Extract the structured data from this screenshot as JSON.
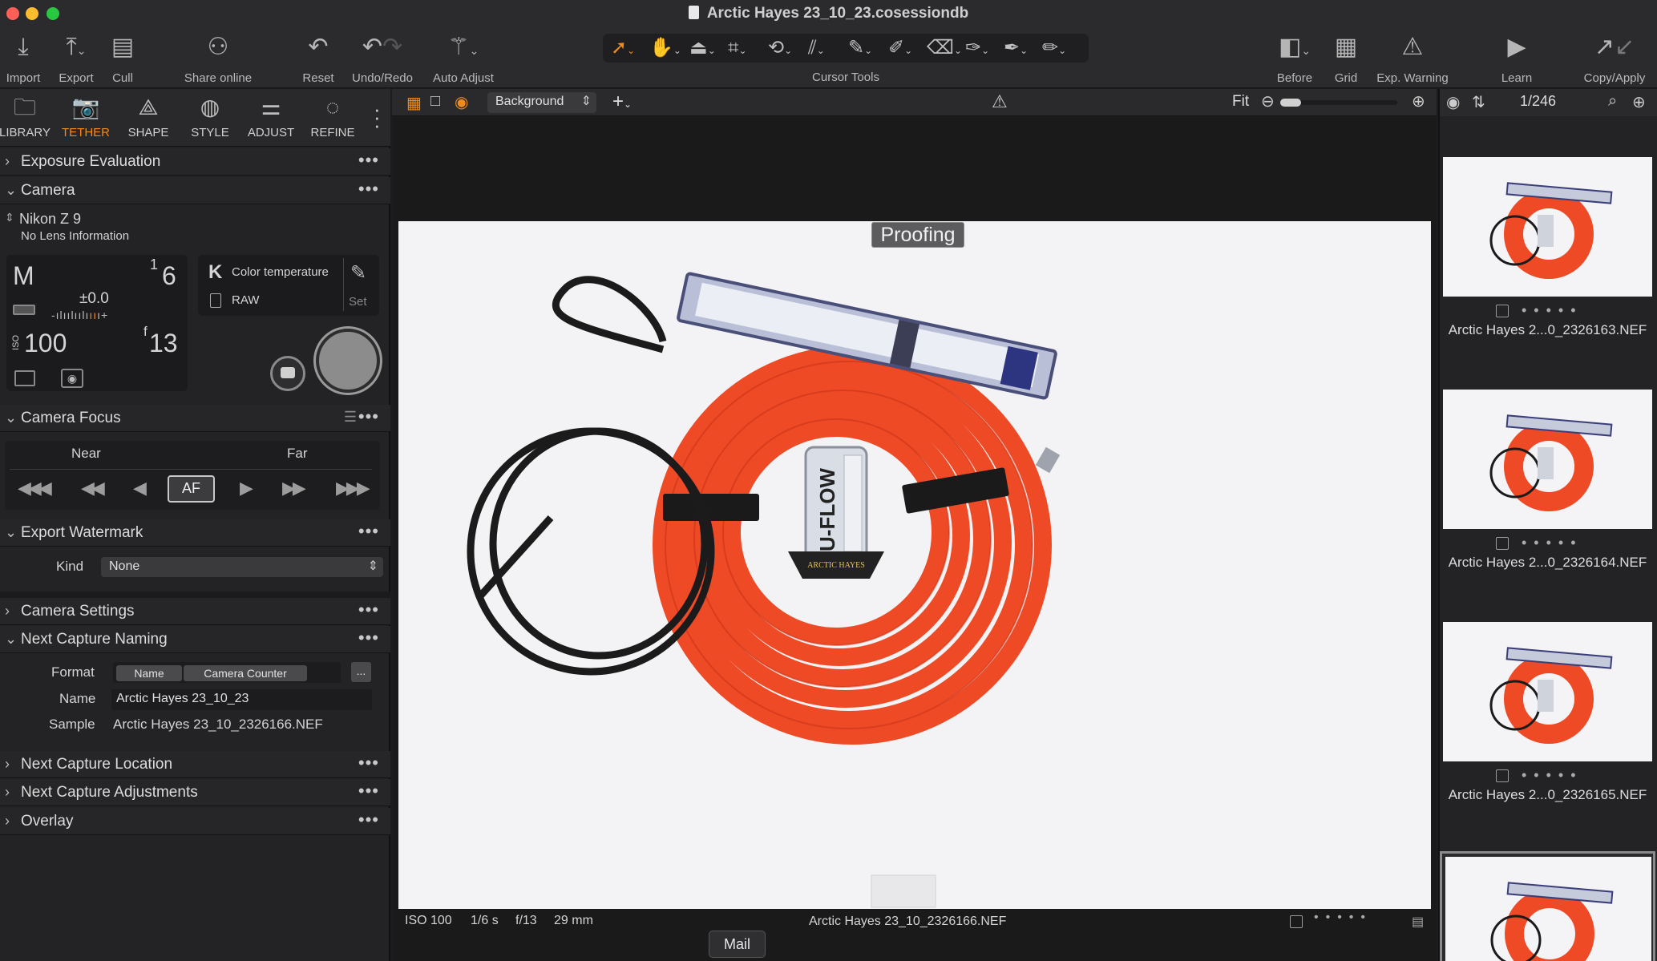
{
  "window": {
    "title": "Arctic Hayes 23_10_23.cosessiondb"
  },
  "toolbar": {
    "import": "Import",
    "export": "Export",
    "cull": "Cull",
    "share_online": "Share online",
    "reset": "Reset",
    "undo_redo": "Undo/Redo",
    "auto_adjust": "Auto Adjust",
    "cursor_tools": "Cursor Tools",
    "before": "Before",
    "grid": "Grid",
    "exp_warning": "Exp. Warning",
    "learn": "Learn",
    "copy_apply": "Copy/Apply"
  },
  "tool_tabs": [
    "LIBRARY",
    "TETHER",
    "SHAPE",
    "STYLE",
    "ADJUST",
    "REFINE"
  ],
  "active_tab": "TETHER",
  "sections": {
    "exposure_evaluation": "Exposure Evaluation",
    "camera": "Camera",
    "camera_focus": "Camera Focus",
    "export_watermark": "Export Watermark",
    "camera_settings": "Camera Settings",
    "next_capture_naming": "Next Capture Naming",
    "next_capture_location": "Next Capture Location",
    "next_capture_adjustments": "Next Capture Adjustments",
    "overlay": "Overlay"
  },
  "camera": {
    "model": "Nikon Z 9",
    "lens": "No Lens Information",
    "mode": "M",
    "shutter_num": "1",
    "shutter_den": "6",
    "exposure_comp": "±0.0",
    "iso_label": "ISO",
    "iso": "100",
    "aperture_f": "f",
    "aperture": "13",
    "wb_letter": "K",
    "wb_label": "Color temperature",
    "format": "RAW",
    "set_label": "Set"
  },
  "focus": {
    "near": "Near",
    "far": "Far",
    "af": "AF"
  },
  "watermark": {
    "kind_label": "Kind",
    "kind_value": "None"
  },
  "naming": {
    "format_label": "Format",
    "format_tokens": [
      "Name",
      "Camera Counter"
    ],
    "more": "...",
    "name_label": "Name",
    "name_value": "Arctic Hayes 23_10_23",
    "sample_label": "Sample",
    "sample_value": "Arctic Hayes 23_10_2326166.NEF"
  },
  "viewer": {
    "variant": "Background",
    "fit": "Fit",
    "proofing": "Proofing",
    "status": {
      "iso": "ISO 100",
      "shutter": "1/6 s",
      "aperture": "f/13",
      "focal": "29 mm",
      "filename": "Arctic Hayes 23_10_2326166.NEF"
    },
    "tooltip": "Mail"
  },
  "photo_labels": {
    "brand": "U-FLOW",
    "logo": "ARCTIC HAYES"
  },
  "browser": {
    "count": "1/246",
    "thumbs": [
      "Arctic Hayes 2...0_2326163.NEF",
      "Arctic Hayes 2...0_2326164.NEF",
      "Arctic Hayes 2...0_2326165.NEF"
    ]
  },
  "colors": {
    "accent": "#f08a1c",
    "hose": "#f0502c",
    "panel": "#232325"
  }
}
